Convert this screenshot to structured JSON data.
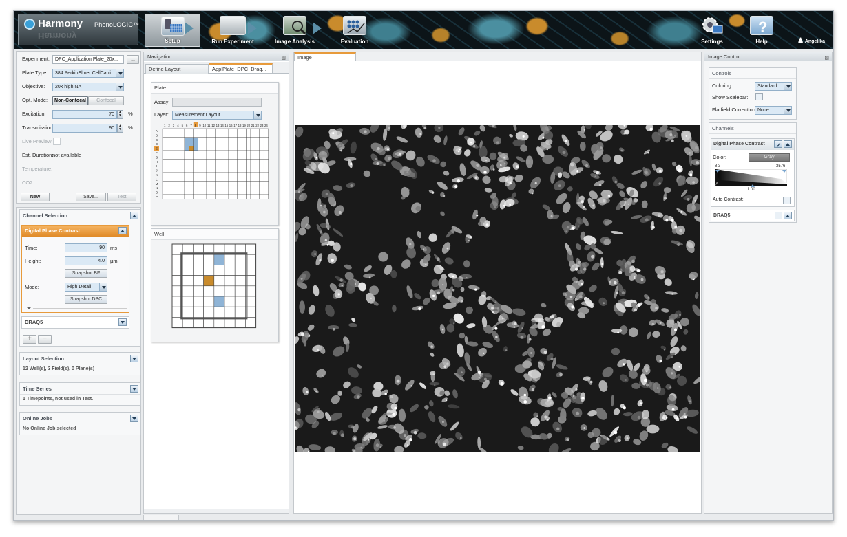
{
  "app": {
    "brand": "Harmony",
    "brand_sub": "PhenoLOGIC™",
    "user": "Angelika"
  },
  "nav": {
    "setup": "Setup",
    "run_experiment": "Run Experiment",
    "image_analysis": "Image Analysis",
    "evaluation": "Evaluation",
    "settings": "Settings",
    "help": "Help"
  },
  "experiment": {
    "experiment_label": "Experiment:",
    "experiment_value": "DPC_Application Plate_20x...",
    "browse": "...",
    "plate_type_label": "Plate Type:",
    "plate_type_value": "384 PerkinElmer CellCarri...",
    "objective_label": "Objective:",
    "objective_value": "20x high NA",
    "opt_mode_label": "Opt. Mode:",
    "opt_mode_nonconfocal": "Non-Confocal",
    "opt_mode_confocal": "Confocal",
    "excitation_label": "Excitation:",
    "excitation_value": "70",
    "transmission_label": "Transmission:",
    "transmission_value": "90",
    "percent": "%",
    "live_preview_label": "Live Preview:",
    "est_duration_label": "Est. Duration:",
    "est_duration_value": "not available",
    "temperature_label": "Temperature:",
    "co2_label": "CO2:",
    "new_button": "New",
    "save_button": "Save...",
    "test_button": "Test"
  },
  "channel_selection": {
    "title": "Channel Selection",
    "channel1": "Digital Phase Contrast",
    "time_label": "Time:",
    "time_value": "90",
    "time_unit": "ms",
    "height_label": "Height:",
    "height_value": "4.0",
    "height_unit": "µm",
    "snapshot_bf": "Snapshot BF",
    "mode_label": "Mode:",
    "mode_value": "High Detail",
    "snapshot_dpc": "Snapshot DPC",
    "channel2": "DRAQ5",
    "add": "+",
    "remove": "−"
  },
  "layout_selection": {
    "title": "Layout Selection",
    "summary": "12 Well(s), 3 Field(s), 0 Plane(s)"
  },
  "time_series": {
    "title": "Time Series",
    "summary": "1 Timepoints, not used in Test."
  },
  "online_jobs": {
    "title": "Online Jobs",
    "summary": "No Online Job selected"
  },
  "navigation": {
    "title": "Navigation",
    "tab_define_layout": "Define Layout",
    "tab_plate": "ApplPlate_DPC_Draq...",
    "plate_title": "Plate",
    "assay_label": "Assay:",
    "layer_label": "Layer:",
    "layer_value": "Measurement Layout",
    "well_title": "Well",
    "columns": [
      "1",
      "2",
      "3",
      "4",
      "5",
      "6",
      "7",
      "8",
      "9",
      "10",
      "11",
      "12",
      "13",
      "14",
      "15",
      "16",
      "17",
      "18",
      "19",
      "20",
      "21",
      "22",
      "23",
      "24"
    ],
    "rows": [
      "A",
      "B",
      "C",
      "D",
      "E",
      "F",
      "G",
      "H",
      "I",
      "J",
      "K",
      "L",
      "M",
      "N",
      "O",
      "P"
    ],
    "selected_column": "8",
    "selected_row": "E"
  },
  "image": {
    "title": "Image"
  },
  "image_control": {
    "title": "Image Control",
    "controls_title": "Controls",
    "coloring_label": "Coloring:",
    "coloring_value": "Standard",
    "scalebar_label": "Show Scalebar:",
    "flatfield_label": "Flatfield Correction:",
    "flatfield_value": "None",
    "channels_title": "Channels",
    "channel1": "Digital Phase Contrast",
    "color_label": "Color:",
    "color_value": "Gray",
    "min_value": "8.3",
    "max_value": "3576",
    "gamma_value": "1.00",
    "auto_contrast_label": "Auto Contrast:",
    "channel2": "DRAQ5"
  },
  "colors": {
    "accent_orange": "#e79a3b",
    "selected_blue": "#8fb4d6",
    "selected_orange": "#c98b2c"
  },
  "icons": [
    "setup-icon",
    "run-experiment-icon",
    "image-analysis-icon",
    "evaluation-icon",
    "settings-icon",
    "help-icon",
    "user-icon",
    "pin-icon"
  ]
}
